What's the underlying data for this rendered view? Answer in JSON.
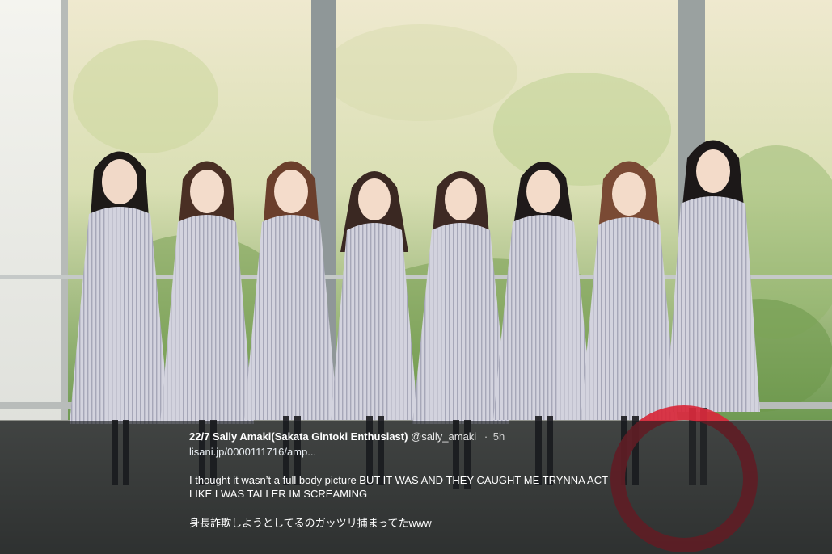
{
  "tweet": {
    "display_name": "22/7 Sally Amaki(Sakata Gintoki Enthusiast)",
    "handle": "@sally_amaki",
    "separator": "·",
    "time": "5h",
    "link": "lisani.jp/0000111716/amp...",
    "body_line1": "I thought it wasn’t a full body picture BUT IT WAS AND THEY CAUGHT ME TRYNNA ACT",
    "body_line2": "LIKE I WAS TALLER IM SCREAMING",
    "body_jp": "身長詐欺しようとしてるのガッツリ捕まってたwww"
  },
  "photo": {
    "subject": "group photo of eight members in grey striped uniforms",
    "members": 8
  },
  "annotation": {
    "type": "red-circle",
    "color": "#d8283a"
  },
  "colors": {
    "overlay": "#141618",
    "text": "#ffffff",
    "circle": "#d8283a"
  }
}
